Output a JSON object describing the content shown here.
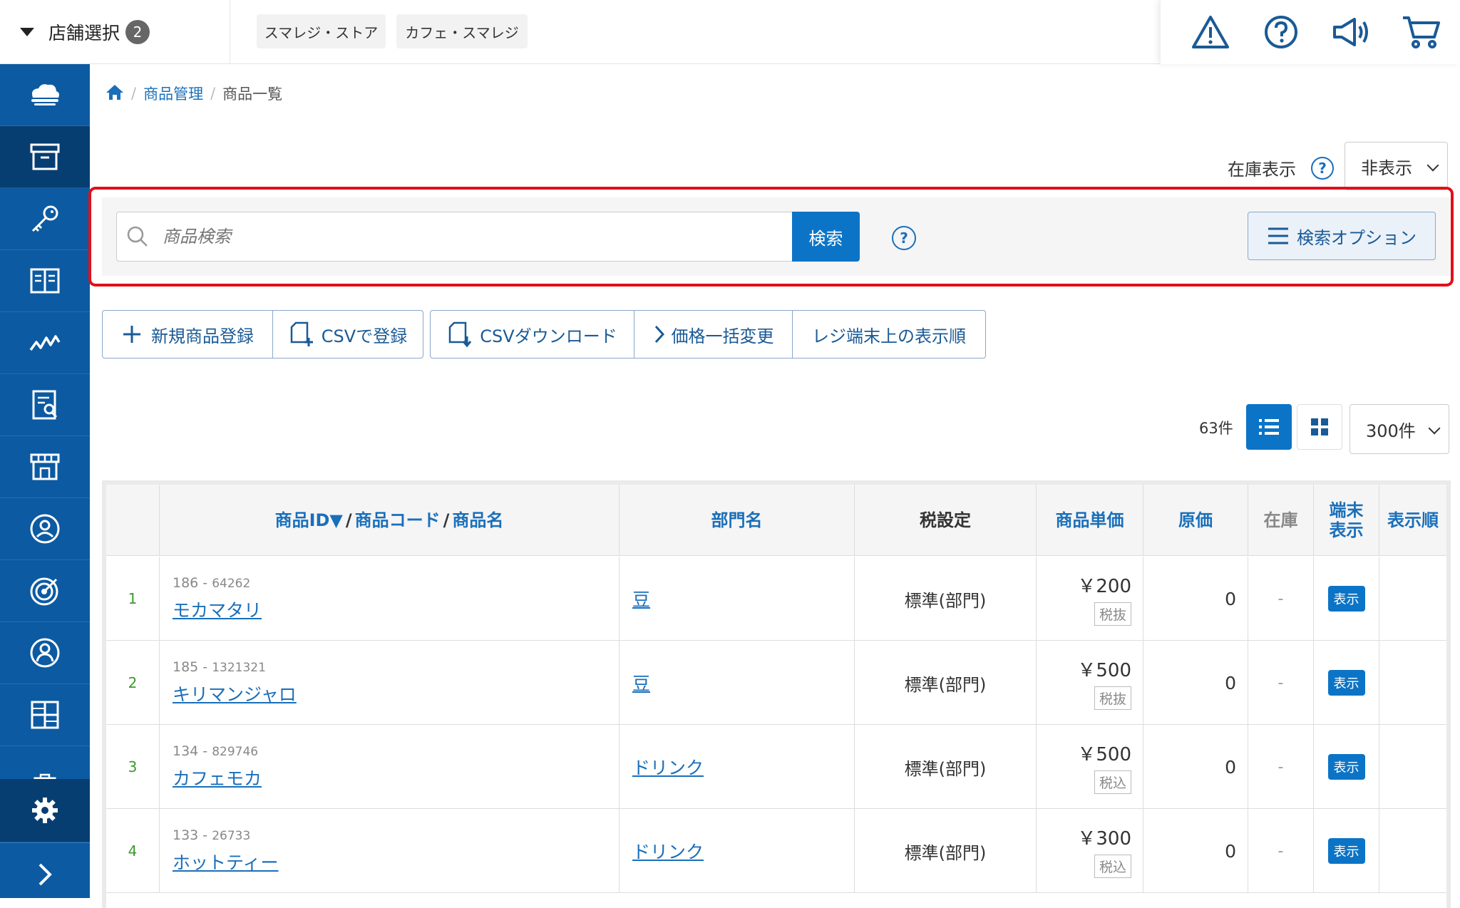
{
  "topbar": {
    "store_select_label": "店舗選択",
    "store_count": "2",
    "store_tabs": [
      "スマレジ・ストア",
      "カフェ・スマレジ"
    ],
    "icons": [
      "warning-icon",
      "help-icon",
      "megaphone-icon",
      "cart-icon"
    ]
  },
  "sidebar": {
    "items": [
      "cloud-icon",
      "box-icon",
      "key-icon",
      "book-icon",
      "chart-icon",
      "report-icon",
      "store-icon",
      "customer-icon",
      "target-icon",
      "user-icon",
      "grid-icon",
      "clipboard-icon"
    ],
    "active_index": 1,
    "bottom": [
      "gear-icon",
      "chevron-right-icon"
    ]
  },
  "breadcrumb": {
    "level1": "商品管理",
    "current": "商品一覧"
  },
  "stock_display": {
    "label": "在庫表示",
    "help": "?",
    "value": "非表示"
  },
  "search": {
    "placeholder": "商品検索",
    "button": "検索",
    "help": "?",
    "options_button": "検索オプション"
  },
  "actions": {
    "group1": [
      "新規商品登録",
      "CSVで登録"
    ],
    "group2": [
      "CSVダウンロード",
      "価格一括変更",
      "レジ端末上の表示順"
    ]
  },
  "list": {
    "count": "63件",
    "per_page": "300件"
  },
  "table": {
    "headers": {
      "id_name_part1": "商品ID▼",
      "slash1": "/",
      "id_name_part2": "商品コード",
      "slash2": "/",
      "id_name_part3": "商品名",
      "dept": "部門名",
      "tax": "税設定",
      "price": "商品単価",
      "cost": "原価",
      "stock": "在庫",
      "terminal": "端末表示",
      "order": "表示順"
    },
    "rows": [
      {
        "num": "1",
        "id": "186",
        "code": "64262",
        "name": "モカマタリ",
        "dept": "豆",
        "tax": "標準(部門)",
        "price": "￥200",
        "tax_type": "税抜",
        "cost": "0",
        "stock": "-",
        "display": "表示"
      },
      {
        "num": "2",
        "id": "185",
        "code": "1321321",
        "name": "キリマンジャロ",
        "dept": "豆",
        "tax": "標準(部門)",
        "price": "￥500",
        "tax_type": "税抜",
        "cost": "0",
        "stock": "-",
        "display": "表示"
      },
      {
        "num": "3",
        "id": "134",
        "code": "829746",
        "name": "カフェモカ",
        "dept": "ドリンク",
        "tax": "標準(部門)",
        "price": "￥500",
        "tax_type": "税込",
        "cost": "0",
        "stock": "-",
        "display": "表示"
      },
      {
        "num": "4",
        "id": "133",
        "code": "26733",
        "name": "ホットティー",
        "dept": "ドリンク",
        "tax": "標準(部門)",
        "price": "￥300",
        "tax_type": "税込",
        "cost": "0",
        "stock": "-",
        "display": "表示"
      }
    ]
  },
  "colors": {
    "primary": "#0c74c6",
    "sidebar": "#0c5aa2",
    "sidebar_active": "#073e72",
    "highlight": "#e0101a",
    "row_number": "#3a9a2a"
  }
}
